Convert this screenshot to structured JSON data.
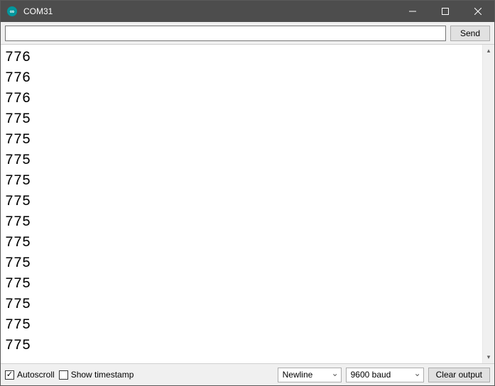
{
  "titlebar": {
    "title": "COM31",
    "icon_name": "arduino-icon"
  },
  "input": {
    "value": "",
    "placeholder": ""
  },
  "send_label": "Send",
  "output_lines": [
    "776",
    "776",
    "776",
    "775",
    "775",
    "775",
    "775",
    "775",
    "775",
    "775",
    "775",
    "775",
    "775",
    "775",
    "775"
  ],
  "footer": {
    "autoscroll_label": "Autoscroll",
    "autoscroll_checked": true,
    "show_timestamp_label": "Show timestamp",
    "show_timestamp_checked": false,
    "line_ending": "Newline",
    "baud": "9600 baud",
    "clear_label": "Clear output"
  }
}
